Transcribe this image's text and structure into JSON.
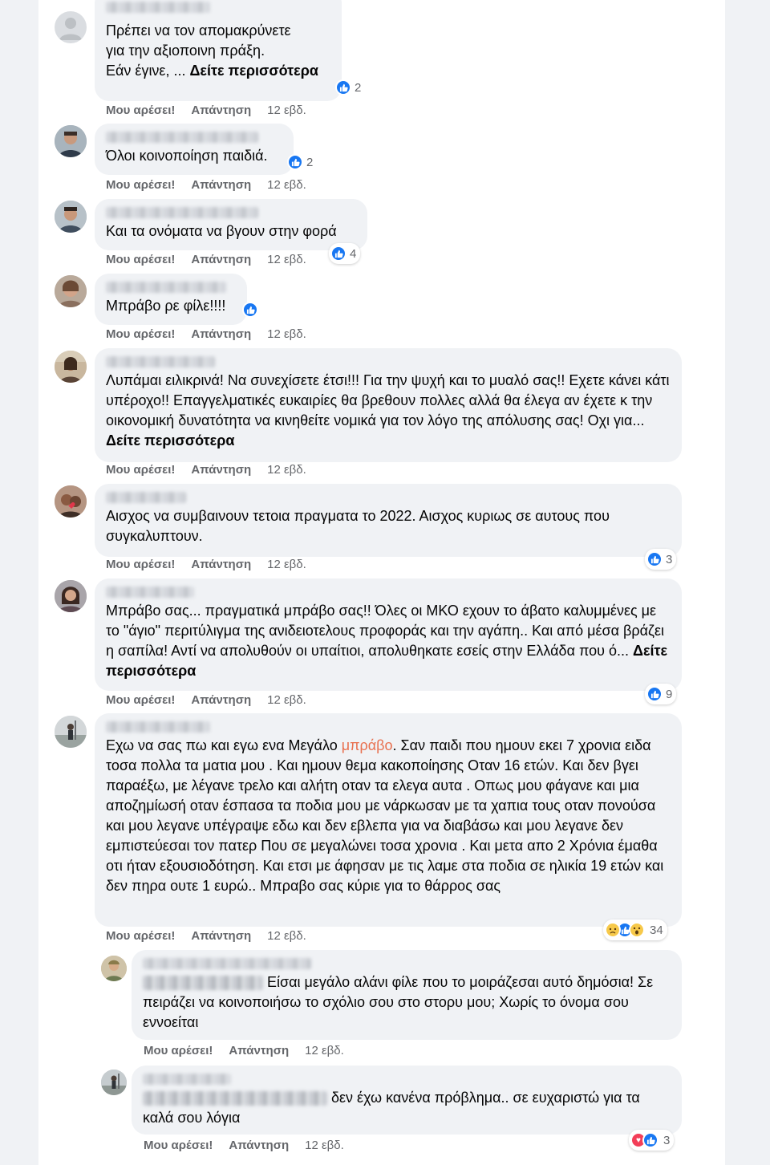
{
  "labels": {
    "like": "Μου αρέσει!",
    "reply": "Απάντηση",
    "see_more": "Δείτε περισσότερα"
  },
  "colors": {
    "bubble": "#f0f2f5",
    "like_blue": "#1877f2",
    "highlight": "#e8704f",
    "meta": "#65676b"
  },
  "comments": [
    {
      "text": "Πρέπει να τον απομακρύνετε\nγια την αξιοποινη πράξη.\nΕάν έγινε, ...",
      "see_more": true,
      "time": "12 εβδ.",
      "reactions": {
        "icons": [
          "like-icon"
        ],
        "count": "2"
      }
    },
    {
      "text": "Όλοι κοινοποίηση παιδιά.",
      "time": "12 εβδ.",
      "reactions": {
        "icons": [
          "like-icon"
        ],
        "count": "2"
      }
    },
    {
      "text": "Και τα ονόματα να βγουν στην φορά",
      "time": "12 εβδ.",
      "reactions": {
        "icons": [
          "like-icon"
        ],
        "count": "4"
      }
    },
    {
      "text": "Μπράβο ρε φίλε!!!!",
      "time": "12 εβδ.",
      "reactions": {
        "icons": [
          "like-icon"
        ],
        "count": ""
      }
    },
    {
      "text": "Λυπάμαι ειλικρινά! Να συνεχίσετε έτσι!!! Για την ψυχή και το μυαλό σας!! Εχετε κάνει κάτι υπέροχο!! Επαγγελματικές ευκαιρίες θα βρεθουν πολλες αλλά θα έλεγα αν έχετε κ την οικονομική δυνατότητα να κινηθείτε νομικά για τον λόγο της απόλυσης σας! Οχι για...",
      "see_more": true,
      "time": "12 εβδ."
    },
    {
      "text": "Αισχος να συμβαινουν τετοια πραγματα το 2022. Αισχος κυριως σε αυτους που συγκαλυπτουν.",
      "time": "12 εβδ.",
      "reactions": {
        "icons": [
          "like-icon"
        ],
        "count": "3"
      }
    },
    {
      "text": "Μπράβο σας... πραγματικά μπράβο σας!! Όλες οι ΜΚΟ εχουν το άβατο καλυμμένες με το \"άγιο\" περιτύλιγμα της ανιδειοτελους προφοράς και την αγάπη.. Και από μέσα βράζει η σαπίλα! Αντί να απολυθούν οι υπαίτιοι, απολυθηκατε εσείς στην Ελλάδα που ό...",
      "see_more": true,
      "time": "12 εβδ.",
      "reactions": {
        "icons": [
          "like-icon"
        ],
        "count": "9"
      }
    },
    {
      "text_before": "Εχω να σας πω και εγω ενα Μεγάλο ",
      "text_highlight": "μπράβο",
      "text_after": ". Σαν παιδι που ημουν εκει 7 χρονια ειδα τοσα πολλα τα ματια μου . Και ημουν θεμα κακοποίησης Οταν 16 ετών. Και δεν βγει παραέξω, με λέγανε τρελο και αλήτη οταν τα ελεγα αυτα . Οπως μου φάγανε και μια αποζημίωσή οταν έσπασα τα ποδια μου με νάρκωσαν με τα χαπια τους οταν πονούσα και μου λεγανε υπέγραψε εδω και δεν εβλεπα για να διαβάσω και μου λεγανε δεν εμπιστεύεσαι τον πατερ Που σε μεγαλώνει τοσα χρονια . Και μετα απο 2 Χρόνια έμαθα οτι ήταν εξουσιοδότηση. Και ετσι με άφησαν με τις λαμε στα ποδια σε ηλικία 19 ετών και δεν πηρα ουτε 1 ευρώ.. Μπραβο σας κύριε για το θάρρος σας",
      "time": "12 εβδ.",
      "reactions": {
        "icons": [
          "sad-icon",
          "like-icon",
          "wow-icon"
        ],
        "count": "34"
      }
    },
    {
      "text": "Είσαι μεγάλο αλάνι φίλε που το μοιράζεσαι αυτό δημόσια! Σε πειράζει να κοινοποιήσω το σχόλιο σου στο στορυ μου; Χωρίς το όνομα σου εννοείται",
      "time": "12 εβδ."
    },
    {
      "text": "δεν έχω κανένα πρόβλημα.. σε ευχαριστώ για τα καλά σου λόγια",
      "time": "12 εβδ.",
      "reactions": {
        "icons": [
          "love-icon",
          "like-icon"
        ],
        "count": "3"
      }
    }
  ]
}
